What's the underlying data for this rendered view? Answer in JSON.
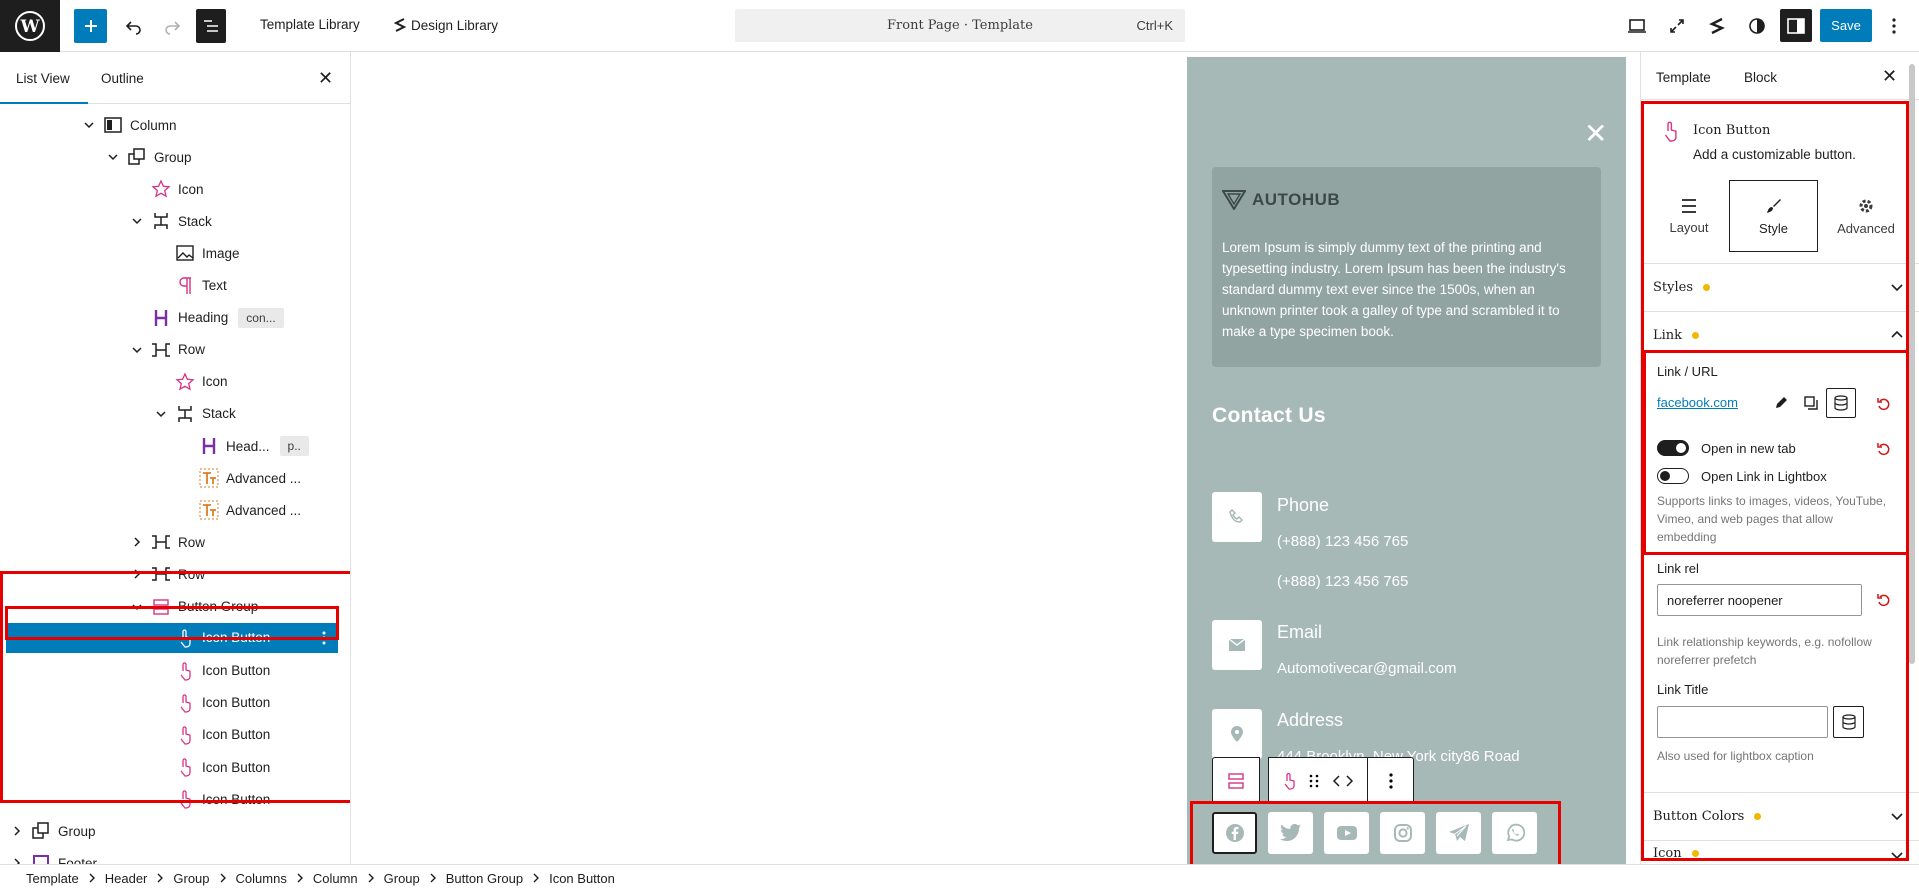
{
  "topbar": {
    "template_library": "Template Library",
    "design_library": "Design Library",
    "doc_title": "Front Page · Template",
    "shortcut": "Ctrl+K",
    "save": "Save"
  },
  "left_panel": {
    "tabs": [
      "List View",
      "Outline"
    ],
    "items": [
      {
        "label": "Column",
        "icon": "column-icon",
        "depth": 0,
        "chevron": "down"
      },
      {
        "label": "Group",
        "icon": "group-icon",
        "depth": 1,
        "chevron": "down"
      },
      {
        "label": "Icon",
        "icon": "star-icon",
        "depth": 2,
        "chevron": ""
      },
      {
        "label": "Stack",
        "icon": "stack-icon",
        "depth": 2,
        "chevron": "down"
      },
      {
        "label": "Image",
        "icon": "image-icon",
        "depth": 3,
        "chevron": ""
      },
      {
        "label": "Text",
        "icon": "paragraph-icon",
        "depth": 3,
        "chevron": ""
      },
      {
        "label": "Heading",
        "icon": "heading-icon",
        "depth": 2,
        "chevron": "",
        "badge": "con..."
      },
      {
        "label": "Row",
        "icon": "row-icon",
        "depth": 2,
        "chevron": "down"
      },
      {
        "label": "Icon",
        "icon": "star-icon",
        "depth": 3,
        "chevron": ""
      },
      {
        "label": "Stack",
        "icon": "stack-icon",
        "depth": 3,
        "chevron": "down"
      },
      {
        "label": "Head...",
        "icon": "heading-icon",
        "depth": 4,
        "chevron": "",
        "badge": "p.."
      },
      {
        "label": "Advanced ...",
        "icon": "advanced-text-icon",
        "depth": 4,
        "chevron": ""
      },
      {
        "label": "Advanced ...",
        "icon": "advanced-text-icon",
        "depth": 4,
        "chevron": ""
      },
      {
        "label": "Row",
        "icon": "row-icon",
        "depth": 2,
        "chevron": "right"
      },
      {
        "label": "Row",
        "icon": "row-icon",
        "depth": 2,
        "chevron": "right"
      },
      {
        "label": "Button Group",
        "icon": "button-group-icon",
        "depth": 2,
        "chevron": "down"
      },
      {
        "label": "Icon Button",
        "icon": "hand-pointer-icon",
        "depth": 3,
        "chevron": "",
        "selected": true
      },
      {
        "label": "Icon Button",
        "icon": "hand-pointer-icon",
        "depth": 3,
        "chevron": ""
      },
      {
        "label": "Icon Button",
        "icon": "hand-pointer-icon",
        "depth": 3,
        "chevron": ""
      },
      {
        "label": "Icon Button",
        "icon": "hand-pointer-icon",
        "depth": 3,
        "chevron": ""
      },
      {
        "label": "Icon Button",
        "icon": "hand-pointer-icon",
        "depth": 3,
        "chevron": ""
      },
      {
        "label": "Icon Button",
        "icon": "hand-pointer-icon",
        "depth": 3,
        "chevron": ""
      },
      {
        "label": "Group",
        "icon": "group-icon",
        "depth": -1,
        "chevron": "right"
      },
      {
        "label": "Footer",
        "icon": "footer-icon",
        "depth": -1,
        "chevron": "right"
      }
    ]
  },
  "canvas": {
    "brand": "AUTOHUB",
    "about_text": "Lorem Ipsum is simply dummy text of the printing and typesetting industry. Lorem Ipsum has been the industry's standard dummy text ever since the 1500s, when an unknown printer took a galley of type and scrambled it to make a type specimen book.",
    "contact_title": "Contact Us",
    "phone_label": "Phone",
    "phone_1": "(+888) 123 456 765",
    "phone_2": "(+888) 123 456 765",
    "email_label": "Email",
    "email_value": "Automotivecar@gmail.com",
    "address_label": "Address",
    "address_value": "444 Brooklyn, New York city86 Road",
    "social": [
      "facebook-icon",
      "twitter-icon",
      "youtube-icon",
      "instagram-icon",
      "telegram-icon",
      "whatsapp-icon"
    ]
  },
  "inspector": {
    "tabs": [
      "Template",
      "Block"
    ],
    "block_name": "Icon Button",
    "block_desc": "Add a customizable button.",
    "segments": [
      "Layout",
      "Style",
      "Advanced"
    ],
    "styles": "Styles",
    "link": "Link",
    "link_url_label": "Link / URL",
    "link_url": "facebook.com",
    "open_new_tab": "Open in new tab",
    "open_lightbox": "Open Link in Lightbox",
    "lightbox_help": "Supports links to images, videos, YouTube, Vimeo, and web pages that allow embedding",
    "link_rel_label": "Link rel",
    "link_rel_value": "noreferrer noopener",
    "link_rel_help": "Link relationship keywords, e.g. nofollow noreferrer prefetch",
    "link_title_label": "Link Title",
    "link_title_value": "",
    "link_title_help": "Also used for lightbox caption",
    "button_colors": "Button Colors",
    "icon_section": "Icon",
    "accent": "#007cba",
    "dot_color": "#f0b800"
  },
  "breadcrumb": [
    "Template",
    "Header",
    "Group",
    "Columns",
    "Column",
    "Group",
    "Button Group",
    "Icon Button"
  ]
}
